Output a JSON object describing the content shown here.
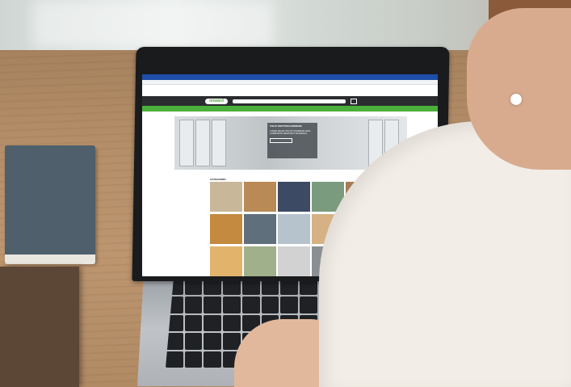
{
  "scene": {
    "description_tags": [
      "desk",
      "laptop",
      "woman",
      "notebook"
    ]
  },
  "website": {
    "logo_text": "onward",
    "notice_bar": "",
    "top_links": [],
    "language": "",
    "nav_items": [],
    "hero": {
      "title": "TOILET PARTITION HARDWARE",
      "subtitle": "A WIDE SELECTION OF SUPERIOR HIGH-CORROSION RESISTANT MATERIALS",
      "button_label": ""
    },
    "categories_title": "CATEGORIES",
    "category_tiles": [
      {
        "color": "#c9b79a"
      },
      {
        "color": "#b98a56"
      },
      {
        "color": "#3c4a63"
      },
      {
        "color": "#7a9b7e"
      },
      {
        "color": "#a67c52"
      },
      {
        "color": "#c48a3f"
      },
      {
        "color": "#5f6f7c"
      },
      {
        "color": "#b6c3cc"
      },
      {
        "color": "#d6b183"
      },
      {
        "color": "#c7c9cc"
      },
      {
        "color": "#e1b36b"
      },
      {
        "color": "#9fb08a"
      },
      {
        "color": "#d2d2d2"
      },
      {
        "color": "#8a8f94"
      },
      {
        "color": "#bfc2c5"
      }
    ]
  },
  "colors": {
    "brand_green": "#4caf3c",
    "header_dark": "#2a2c2f",
    "browser_blue": "#1e4ea8"
  }
}
